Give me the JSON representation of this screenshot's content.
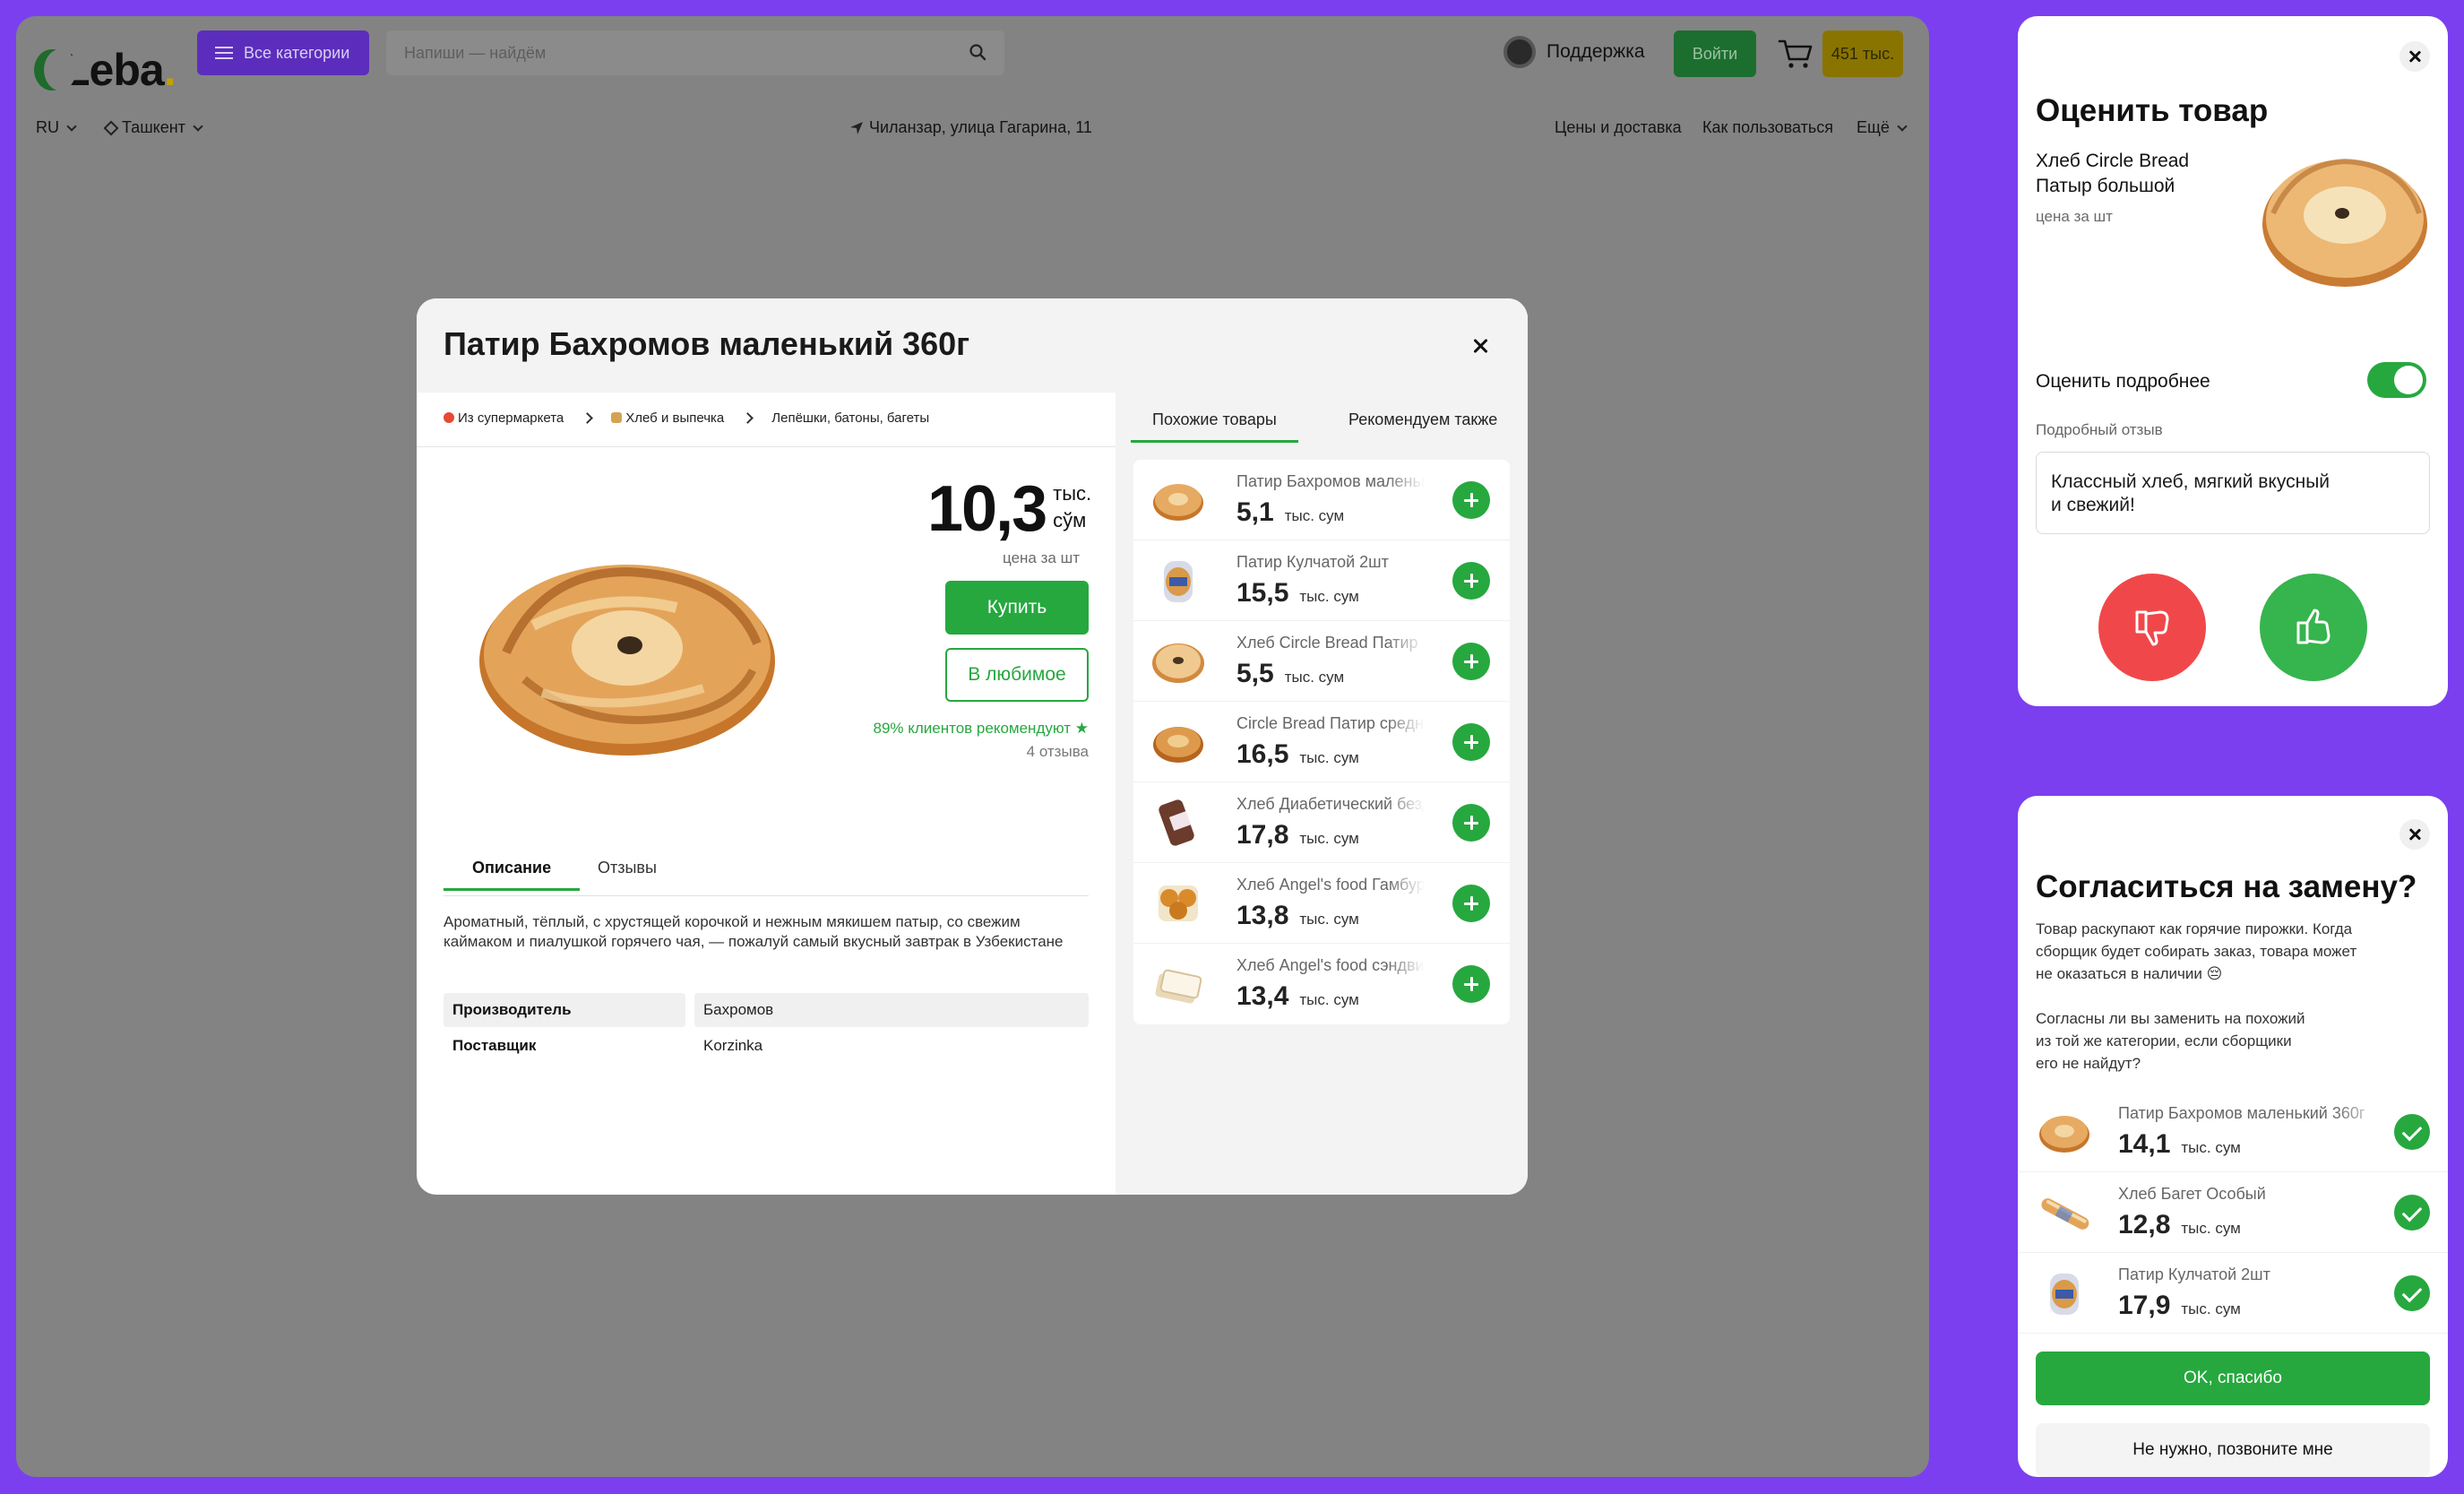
{
  "header": {
    "logo": "Leba",
    "categories_button": "Все категории",
    "search_placeholder": "Напиши — найдём",
    "support": "Поддержка",
    "login": "Войти",
    "cart_total": "451 тыс."
  },
  "subnav": {
    "language": "RU",
    "city": "Ташкент",
    "address": "Чиланзар, улица Гагарина, 11",
    "links": [
      "Цены и доставка",
      "Как пользоваться",
      "Ещё"
    ]
  },
  "product": {
    "title": "Патир Бахромов маленький 360г",
    "breadcrumbs": [
      "Из супермаркета",
      "Хлеб и выпечка",
      "Лепёшки, батоны, багеты"
    ],
    "price": "10,3",
    "currency_line1": "тыс.",
    "currency_line2": "сўм",
    "per_unit": "цена за шт",
    "buy_label": "Купить",
    "favorite_label": "В любимое",
    "recommendation": "89% клиентов рекомендуют ★",
    "reviews_count": "4 отзыва",
    "tabs": [
      "Описание",
      "Отзывы"
    ],
    "description": "Ароматный, тёплый, с хрустящей корочкой и нежным мякишем патыр, со свежим каймаком и пиалушкой горячего чая, — пожалуй самый вкусный завтрак в Узбекистане",
    "specs": [
      {
        "key": "Производитель",
        "value": "Бахромов"
      },
      {
        "key": "Поставщик",
        "value": "Korzinka"
      }
    ]
  },
  "related": {
    "tabs": [
      "Похожие товары",
      "Рекомендуем также"
    ],
    "unit": "тыс. сум",
    "items": [
      {
        "name": "Патир Бахромов маленький",
        "price": "5,1",
        "thumb": "round-pastry"
      },
      {
        "name": "Патир Кулчатой 2шт",
        "price": "15,5",
        "thumb": "packaged-bread"
      },
      {
        "name": "Хлеб Circle Bread Патир большой",
        "price": "5,5",
        "thumb": "round-flat"
      },
      {
        "name": "Circle Bread Патир средний",
        "price": "16,5",
        "thumb": "round-pastry"
      },
      {
        "name": "Хлеб Диабетический бездрожжевой",
        "price": "17,8",
        "thumb": "dark-loaf"
      },
      {
        "name": "Хлеб Angel's food Гамбургер",
        "price": "13,8",
        "thumb": "buns"
      },
      {
        "name": "Хлеб Angel's food сэндвич",
        "price": "13,4",
        "thumb": "sliced"
      }
    ]
  },
  "rate_panel": {
    "title": "Оценить товар",
    "product_name_line1": "Хлеб Circle Bread",
    "product_name_line2": "Патыр большой",
    "per_unit": "цена за шт",
    "detail_toggle_label": "Оценить подробнее",
    "review_label": "Подробный отзыв",
    "review_text_line1": "Классный хлеб, мягкий вкусный",
    "review_text_line2": "и свежий!"
  },
  "substitute_panel": {
    "title": "Согласиться на замену?",
    "text1_line1": "Товар раскупают как горячие пирожки. Когда",
    "text1_line2": "сборщик будет собирать заказ, товара может",
    "text1_line3": "не оказаться в наличии 😔",
    "text2_line1": "Согласны ли вы заменить на похожий",
    "text2_line2": "из той же категории, если сборщики",
    "text2_line3": "его не найдут?",
    "unit": "тыс. сум",
    "items": [
      {
        "name": "Патир Бахромов маленький 360г",
        "price": "14,1",
        "thumb": "round-pastry"
      },
      {
        "name": "Хлеб Багет Особый",
        "price": "12,8",
        "thumb": "baguette"
      },
      {
        "name": "Патир Кулчатой 2шт",
        "price": "17,9",
        "thumb": "packaged-bread"
      }
    ],
    "ok_label": "OK, спасибо",
    "no_label": "Не нужно, позвоните мне"
  }
}
